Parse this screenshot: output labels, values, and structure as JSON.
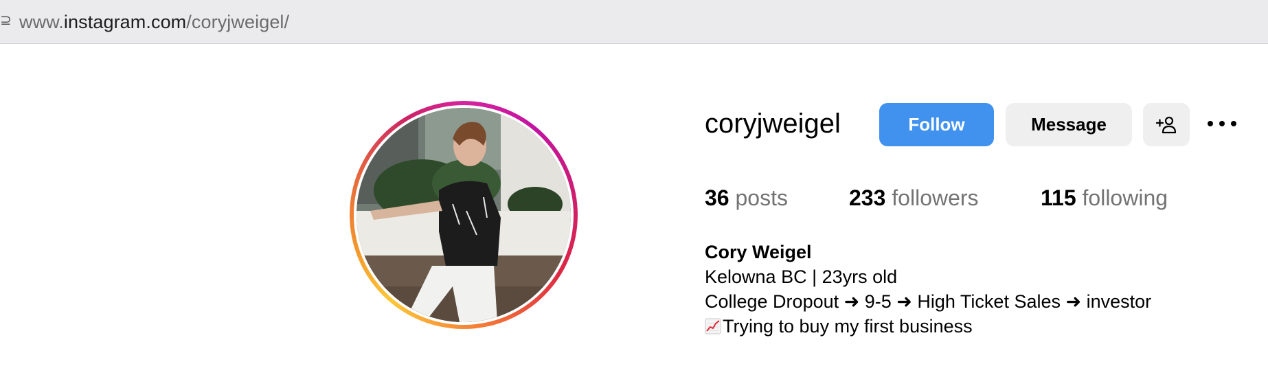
{
  "browser": {
    "url_prefix": "www.",
    "url_host": "instagram.com",
    "url_path": "/coryjweigel/"
  },
  "profile": {
    "username": "coryjweigel",
    "follow_label": "Follow",
    "message_label": "Message",
    "suggest_icon": "person-plus-icon",
    "more_icon": "more-options-icon",
    "accent_color": "#4192ef"
  },
  "stats": {
    "posts_count": "36",
    "posts_label": "posts",
    "followers_count": "233",
    "followers_label": "followers",
    "following_count": "115",
    "following_label": "following"
  },
  "bio": {
    "name": "Cory Weigel",
    "line1": "Kelowna BC | 23yrs old",
    "line2": "College Dropout ➜ 9-5 ➜ High Ticket Sales ➜ investor",
    "line3_emoji": "chart-increasing-icon",
    "line3": "Trying to buy my first business"
  }
}
